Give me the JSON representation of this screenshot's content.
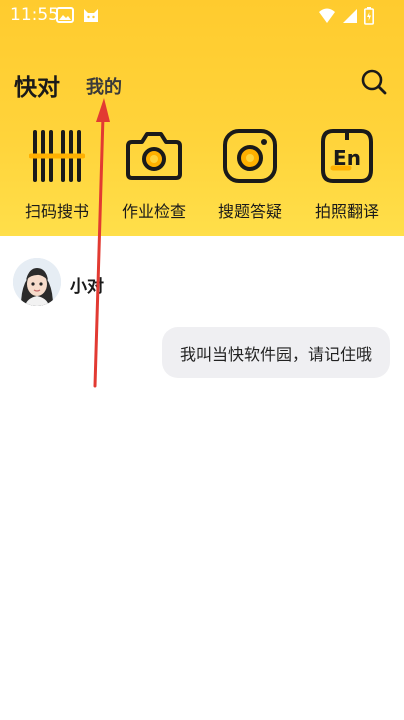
{
  "status_bar": {
    "time": "11:55",
    "left_icons": [
      "image-notify-icon",
      "cat-icon"
    ],
    "right_icons": [
      "wifi-icon",
      "signal-icon",
      "battery-icon"
    ]
  },
  "header": {
    "tabs": [
      {
        "label": "快对",
        "active": true
      },
      {
        "label": "我的",
        "active": false
      }
    ],
    "search_icon": "search-icon"
  },
  "tools": [
    {
      "label": "扫码搜书",
      "icon": "barcode-icon"
    },
    {
      "label": "作业检查",
      "icon": "camera-icon"
    },
    {
      "label": "搜题答疑",
      "icon": "photo-camera-icon"
    },
    {
      "label": "拍照翻译",
      "icon": "translate-en-icon"
    }
  ],
  "chat": {
    "bot_name": "小对",
    "bot_avatar": "avatar-girl",
    "messages": [
      {
        "from": "user",
        "text": "我叫当快软件园，请记住哦"
      }
    ]
  },
  "colors": {
    "header_yellow": "#ffcb2e",
    "icon_accent": "#ffb000",
    "bubble_bg": "#efeff2",
    "annotation_arrow": "#e23a32"
  }
}
